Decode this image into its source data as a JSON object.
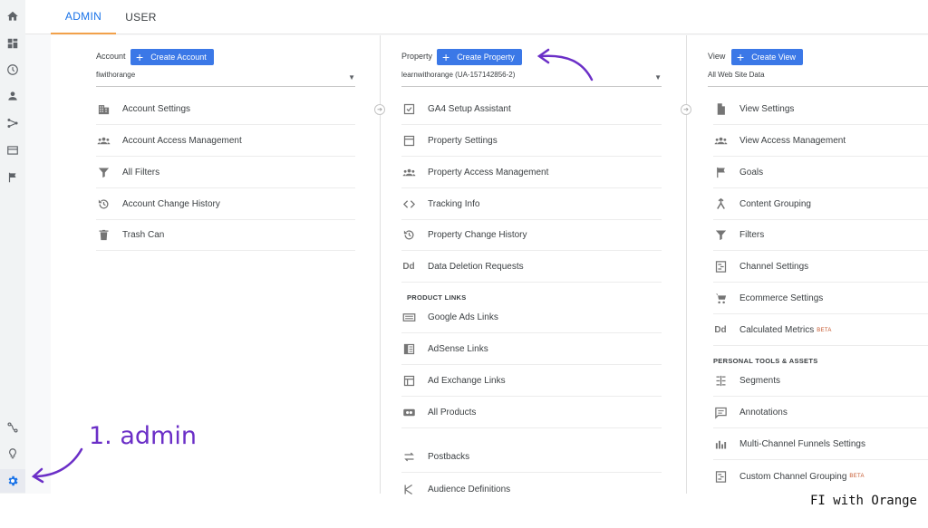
{
  "tabs": {
    "admin": "ADMIN",
    "user": "USER"
  },
  "account": {
    "label": "Account",
    "button": "Create Account",
    "selected": "fiwithorange",
    "items": [
      {
        "label": "Account Settings",
        "icon": "building-icon"
      },
      {
        "label": "Account Access Management",
        "icon": "people-icon"
      },
      {
        "label": "All Filters",
        "icon": "filter-icon"
      },
      {
        "label": "Account Change History",
        "icon": "history-icon"
      },
      {
        "label": "Trash Can",
        "icon": "trash-icon"
      }
    ]
  },
  "property": {
    "label": "Property",
    "button": "Create Property",
    "selected": "learnwithorange (UA-157142856-2)",
    "items": [
      {
        "label": "GA4 Setup Assistant",
        "icon": "checkbox-icon"
      },
      {
        "label": "Property Settings",
        "icon": "window-icon"
      },
      {
        "label": "Property Access Management",
        "icon": "people-icon"
      },
      {
        "label": "Tracking Info",
        "icon": "code-icon"
      },
      {
        "label": "Property Change History",
        "icon": "history-icon"
      },
      {
        "label": "Data Deletion Requests",
        "icon": "dd-icon"
      }
    ],
    "section_label": "PRODUCT LINKS",
    "links": [
      {
        "label": "Google Ads Links",
        "icon": "ads-icon"
      },
      {
        "label": "AdSense Links",
        "icon": "adsense-icon"
      },
      {
        "label": "Ad Exchange Links",
        "icon": "adexchange-icon"
      },
      {
        "label": "All Products",
        "icon": "products-icon"
      },
      {
        "label": "Postbacks",
        "icon": "postbacks-icon"
      },
      {
        "label": "Audience Definitions",
        "icon": "audience-icon"
      }
    ]
  },
  "view": {
    "label": "View",
    "button": "Create View",
    "selected": "All Web Site Data",
    "items": [
      {
        "label": "View Settings",
        "icon": "document-icon"
      },
      {
        "label": "View Access Management",
        "icon": "people-icon"
      },
      {
        "label": "Goals",
        "icon": "flag-icon"
      },
      {
        "label": "Content Grouping",
        "icon": "grouping-icon"
      },
      {
        "label": "Filters",
        "icon": "filter-icon"
      },
      {
        "label": "Channel Settings",
        "icon": "channel-icon"
      },
      {
        "label": "Ecommerce Settings",
        "icon": "cart-icon"
      },
      {
        "label": "Calculated Metrics",
        "icon": "dd-icon",
        "badge": "BETA"
      }
    ],
    "section_label": "PERSONAL TOOLS & ASSETS",
    "tools": [
      {
        "label": "Segments",
        "icon": "segments-icon"
      },
      {
        "label": "Annotations",
        "icon": "comment-icon"
      },
      {
        "label": "Multi-Channel Funnels Settings",
        "icon": "bars-icon"
      },
      {
        "label": "Custom Channel Grouping",
        "icon": "channel-icon",
        "badge": "BETA"
      }
    ]
  },
  "annotation": {
    "text": "1. admin"
  },
  "watermark": "FI with Orange",
  "colors": {
    "accent": "#1a73e8",
    "button": "#3b78e7",
    "annotation": "#6b2fc7",
    "tab_underline": "#f2a14a"
  }
}
